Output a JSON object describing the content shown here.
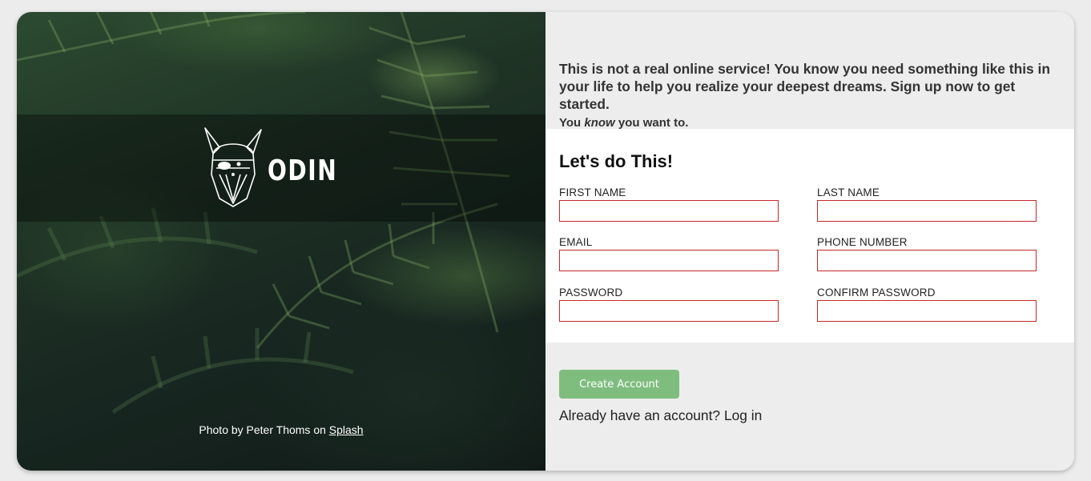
{
  "hero": {
    "logo_text": "ODIN",
    "credit_prefix": "Photo by Peter Thoms on",
    "credit_link": "Splash"
  },
  "intro": {
    "headline": "This is not a real online service! You know you need something like this in your life to help you realize your deepest dreams. Sign up now to get started.",
    "sub_before": "You",
    "sub_emphasis": "know",
    "sub_after": "you want to."
  },
  "form": {
    "title": "Let's do This!",
    "fields": {
      "first_name": {
        "label": "FIRST NAME",
        "value": ""
      },
      "last_name": {
        "label": "LAST NAME",
        "value": ""
      },
      "email": {
        "label": "EMAIL",
        "value": ""
      },
      "phone": {
        "label": "PHONE NUMBER",
        "value": ""
      },
      "password": {
        "label": "PASSWORD",
        "value": ""
      },
      "confirm_password": {
        "label": "CONFIRM PASSWORD",
        "value": ""
      }
    }
  },
  "actions": {
    "create_label": "Create Account",
    "login_prefix": "Already have an account?",
    "login_link": "Log in"
  },
  "colors": {
    "button": "#7fbd7f",
    "input_border": "#c62828",
    "panel_bg": "#ededed"
  },
  "icons": [
    "odin-viking-logo-icon"
  ]
}
